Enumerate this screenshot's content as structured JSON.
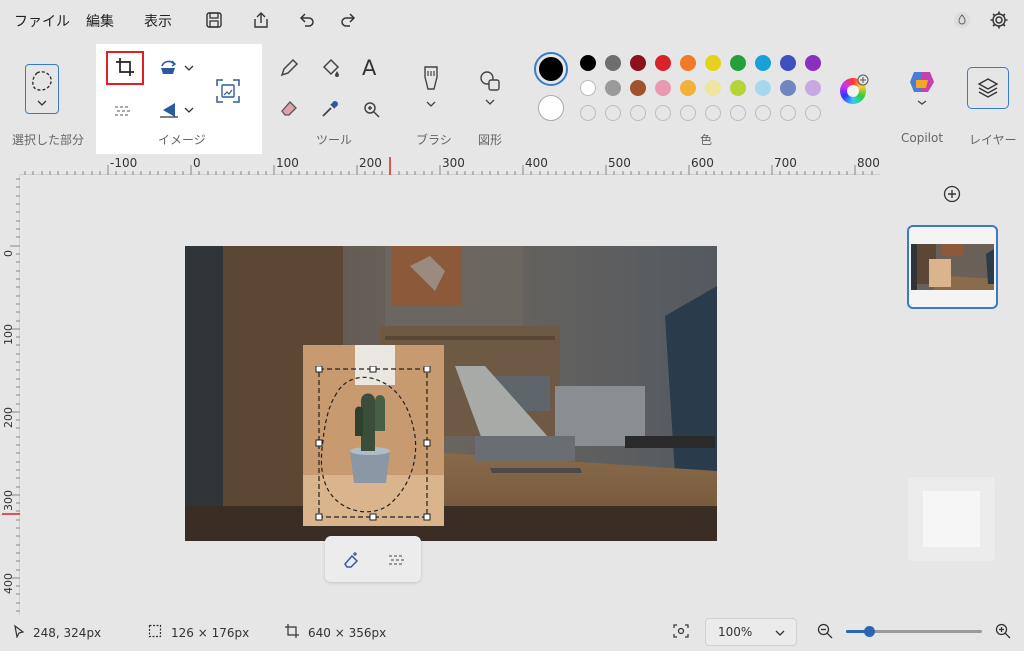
{
  "menu": {
    "file": "ファイル",
    "edit": "編集",
    "view": "表示"
  },
  "ribbon": {
    "selection_label": "選択した部分",
    "image_label": "イメージ",
    "tools_label": "ツール",
    "brushes_label": "ブラシ",
    "shapes_label": "図形",
    "colors_label": "色",
    "copilot_label": "Copilot",
    "layers_label": "レイヤー",
    "text_tool_glyph": "A"
  },
  "colors": {
    "primary": "#000000",
    "secondary": "#ffffff",
    "row1": [
      "#000000",
      "#6e6e6e",
      "#8b1020",
      "#d8232a",
      "#f07a2a",
      "#e6d21b",
      "#23a03a",
      "#1aa0d8",
      "#3f4fbf",
      "#8a2fbf"
    ],
    "row2": [
      "#ffffff",
      "#9a9a9a",
      "#a0522d",
      "#e89ab0",
      "#f2b23a",
      "#efe4a0",
      "#b5d43a",
      "#a8d8ee",
      "#6f86c0",
      "#c7a8e0"
    ]
  },
  "ruler": {
    "h_labels": [
      "-100",
      "0",
      "100",
      "200",
      "300",
      "400",
      "500",
      "600",
      "700",
      "800"
    ],
    "v_labels": [
      "0",
      "100",
      "200",
      "300",
      "400"
    ]
  },
  "status": {
    "cursor": "248, 324px",
    "selection": "126 × 176px",
    "canvas": "640 × 356px",
    "zoom": "100%"
  }
}
